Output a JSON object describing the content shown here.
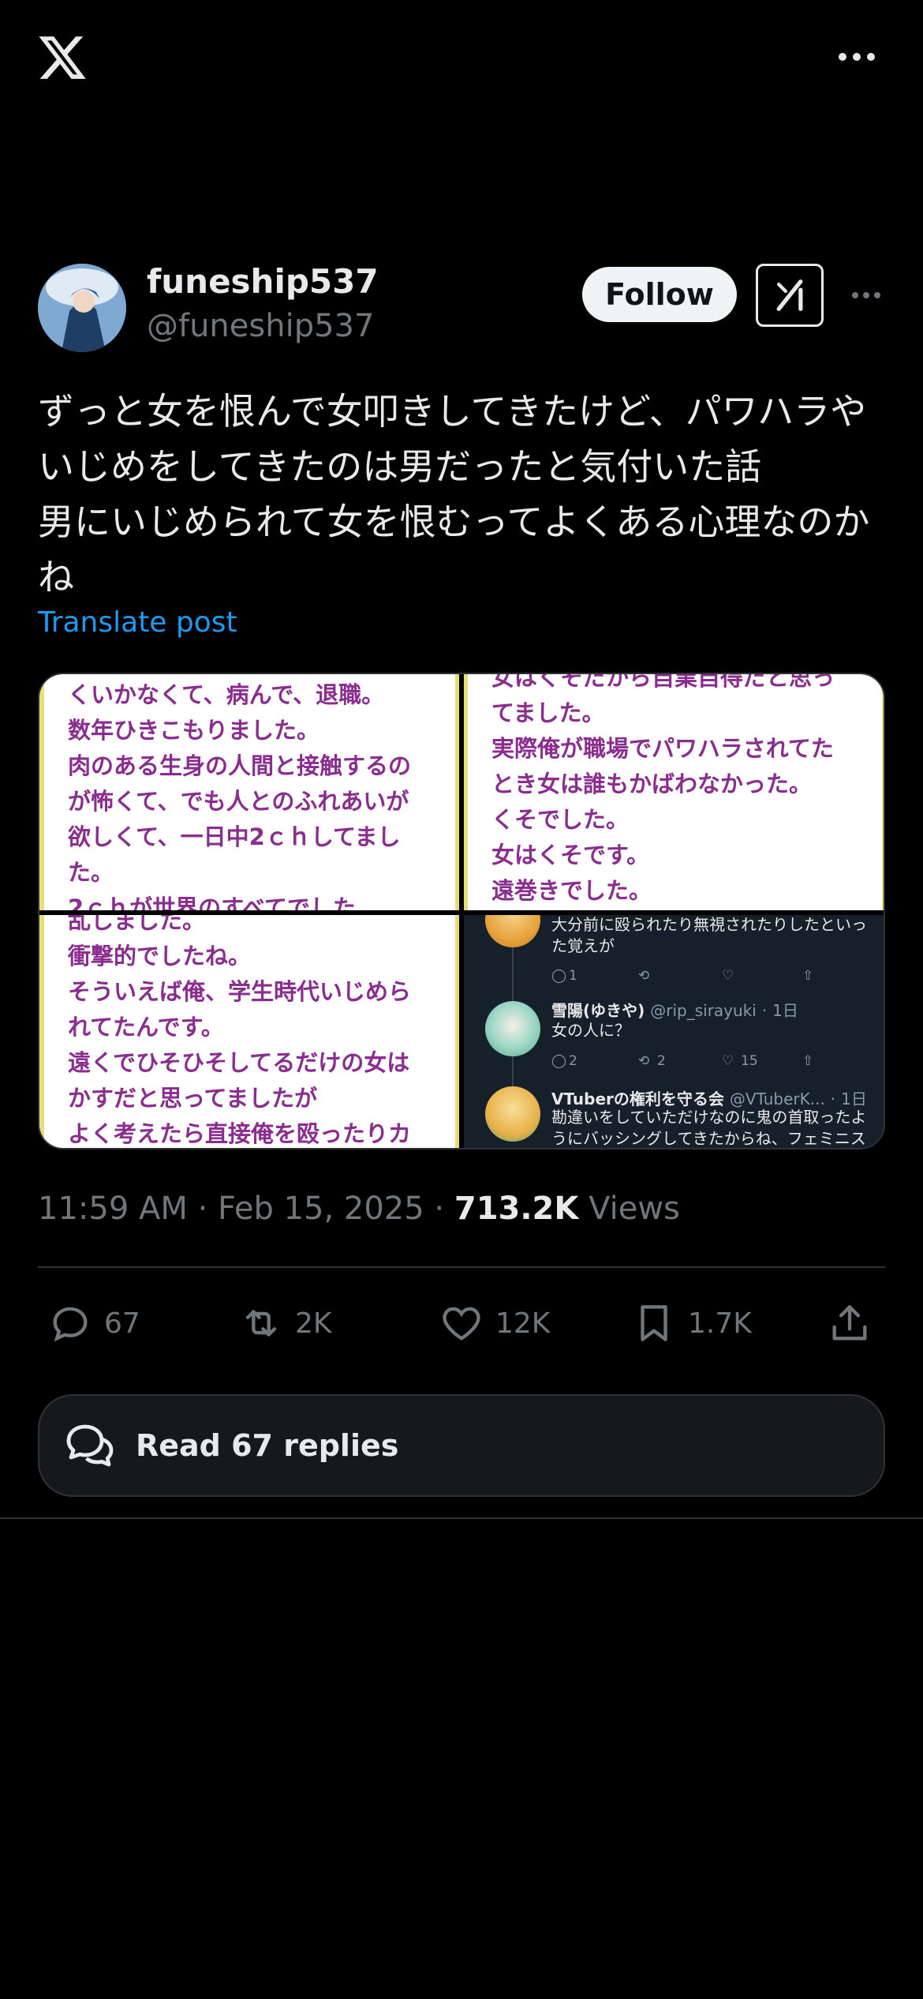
{
  "app": {
    "name": "X"
  },
  "author": {
    "display_name": "funeship537",
    "handle": "@funeship537"
  },
  "header": {
    "follow_label": "Follow"
  },
  "post": {
    "text": "ずっと女を恨んで女叩きしてきたけど、パワハラやいじめをしてきたのは男だったと気付いた話\n男にいじめられて女を恨むってよくある心理なのかね",
    "translate_label": "Translate post",
    "time": "11:59 AM",
    "date": "Feb 15, 2025",
    "views_count": "713.2K",
    "views_label": "Views"
  },
  "media": {
    "tile1_lines": [
      "くいかなくて、病んで、退職。",
      "数年ひきこもりました。",
      "肉のある生身の人間と接触するの",
      "が怖くて、でも人とのふれあいが",
      "欲しくて、一日中2ｃｈしてまし",
      "た。",
      "2ｃｈが世界のすべてでした"
    ],
    "tile2_lines": [
      "女はくそだから自業自得だと思っ",
      "てました。",
      "実際俺が職場でパワハラされてた",
      "とき女は誰もかばわなかった。",
      "くそでした。",
      "女はくそです。",
      "遠巻きでした。"
    ],
    "tile3_lines": [
      "乱しました。",
      "衝撃的でしたね。",
      "そういえば俺、学生時代いじめら",
      "れてたんです。",
      "遠くでひそひそしてるだけの女は",
      "かすだと思ってましたが",
      "よく考えたら直接俺を殴ったりカ"
    ],
    "tile4_replies": [
      {
        "name": "",
        "handle": "",
        "time": "",
        "text": "大分前に殴られたり無視されたりしたといった覚えが",
        "replies": "1",
        "reposts": "",
        "likes": ""
      },
      {
        "name": "雪陽(ゆきや)",
        "handle": "@rip_sirayuki",
        "time": "1日",
        "text": "女の人に？",
        "replies": "2",
        "reposts": "2",
        "likes": "15"
      },
      {
        "name": "VTuberの権利を守る会",
        "handle": "@VTuberK...",
        "time": "1日",
        "text": "勘違いをしていただけなのに鬼の首取ったようにバッシングしてきたからね、フェミニス",
        "replies": "",
        "reposts": "",
        "likes": ""
      }
    ]
  },
  "actions": {
    "replies": "67",
    "reposts": "2K",
    "likes": "12K",
    "bookmarks": "1.7K"
  },
  "read_replies_label": "Read 67 replies",
  "colors": {
    "background": "#000000",
    "link": "#1d9bf0",
    "muted": "#71767b",
    "note_text": "#8a2d8f"
  },
  "icons": [
    "x-logo-icon",
    "more-icon",
    "grok-icon",
    "reply-icon",
    "repost-icon",
    "like-icon",
    "bookmark-icon",
    "share-icon",
    "chat-bubbles-icon"
  ]
}
